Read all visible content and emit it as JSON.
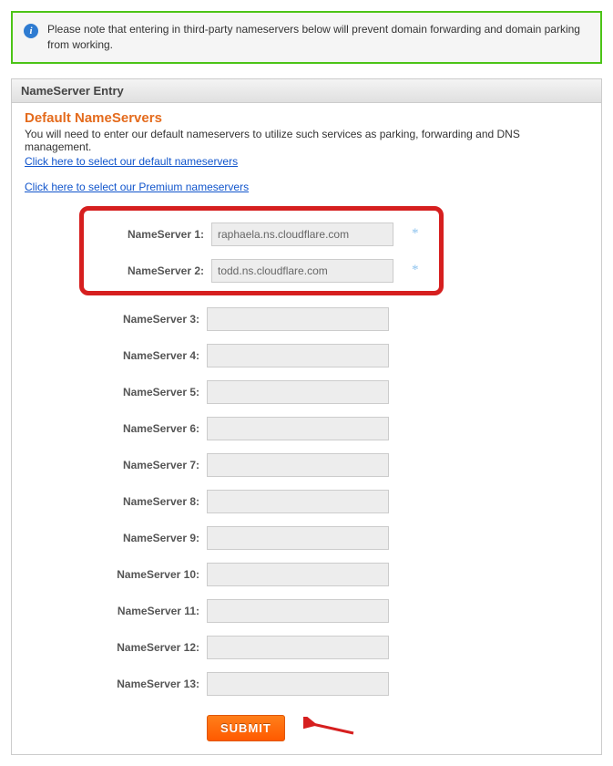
{
  "banner": {
    "text": "Please note that entering in third-party nameservers below will prevent domain forwarding and domain parking from working."
  },
  "panel": {
    "header": "NameServer Entry",
    "section_title": "Default NameServers",
    "section_desc": "You will need to enter our default nameservers to utilize such services as parking, forwarding and DNS management.",
    "link_default": "Click here to select our default nameservers",
    "link_premium": "Click here to select our Premium nameservers"
  },
  "form": {
    "rows": [
      {
        "label": "NameServer 1:",
        "value": "raphaela.ns.cloudflare.com",
        "required": true
      },
      {
        "label": "NameServer 2:",
        "value": "todd.ns.cloudflare.com",
        "required": true
      },
      {
        "label": "NameServer 3:",
        "value": "",
        "required": false
      },
      {
        "label": "NameServer 4:",
        "value": "",
        "required": false
      },
      {
        "label": "NameServer 5:",
        "value": "",
        "required": false
      },
      {
        "label": "NameServer 6:",
        "value": "",
        "required": false
      },
      {
        "label": "NameServer 7:",
        "value": "",
        "required": false
      },
      {
        "label": "NameServer 8:",
        "value": "",
        "required": false
      },
      {
        "label": "NameServer 9:",
        "value": "",
        "required": false
      },
      {
        "label": "NameServer 10:",
        "value": "",
        "required": false
      },
      {
        "label": "NameServer 11:",
        "value": "",
        "required": false
      },
      {
        "label": "NameServer 12:",
        "value": "",
        "required": false
      },
      {
        "label": "NameServer 13:",
        "value": "",
        "required": false
      }
    ],
    "submit_label": "SUBMIT"
  }
}
